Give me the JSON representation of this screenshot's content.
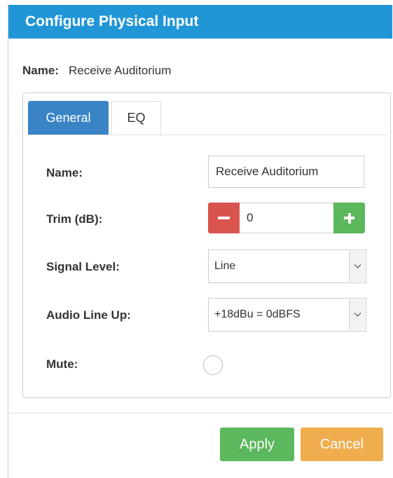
{
  "dialog": {
    "title": "Configure Physical Input",
    "name_label": "Name:",
    "name_value": "Receive Auditorium"
  },
  "tabs": [
    {
      "label": "General",
      "active": true
    },
    {
      "label": "EQ",
      "active": false
    }
  ],
  "form": {
    "name_label": "Name:",
    "name_value": "Receive Auditorium",
    "trim_label": "Trim (dB):",
    "trim_value": "0",
    "signal_level_label": "Signal Level:",
    "signal_level_value": "Line",
    "audio_line_up_label": "Audio Line Up:",
    "audio_line_up_value": "+18dBu = 0dBFS",
    "mute_label": "Mute:",
    "mute_checked": false
  },
  "buttons": {
    "apply": "Apply",
    "cancel": "Cancel"
  },
  "colors": {
    "titlebar": "#2196d6",
    "active_tab": "#3a84c6",
    "minus": "#d9534f",
    "plus": "#5cb85c",
    "apply": "#5cb85c",
    "cancel": "#f0ad4e"
  },
  "icons": {
    "minus": "minus-icon",
    "plus": "plus-icon",
    "dropdown": "chevron-down-icon"
  }
}
